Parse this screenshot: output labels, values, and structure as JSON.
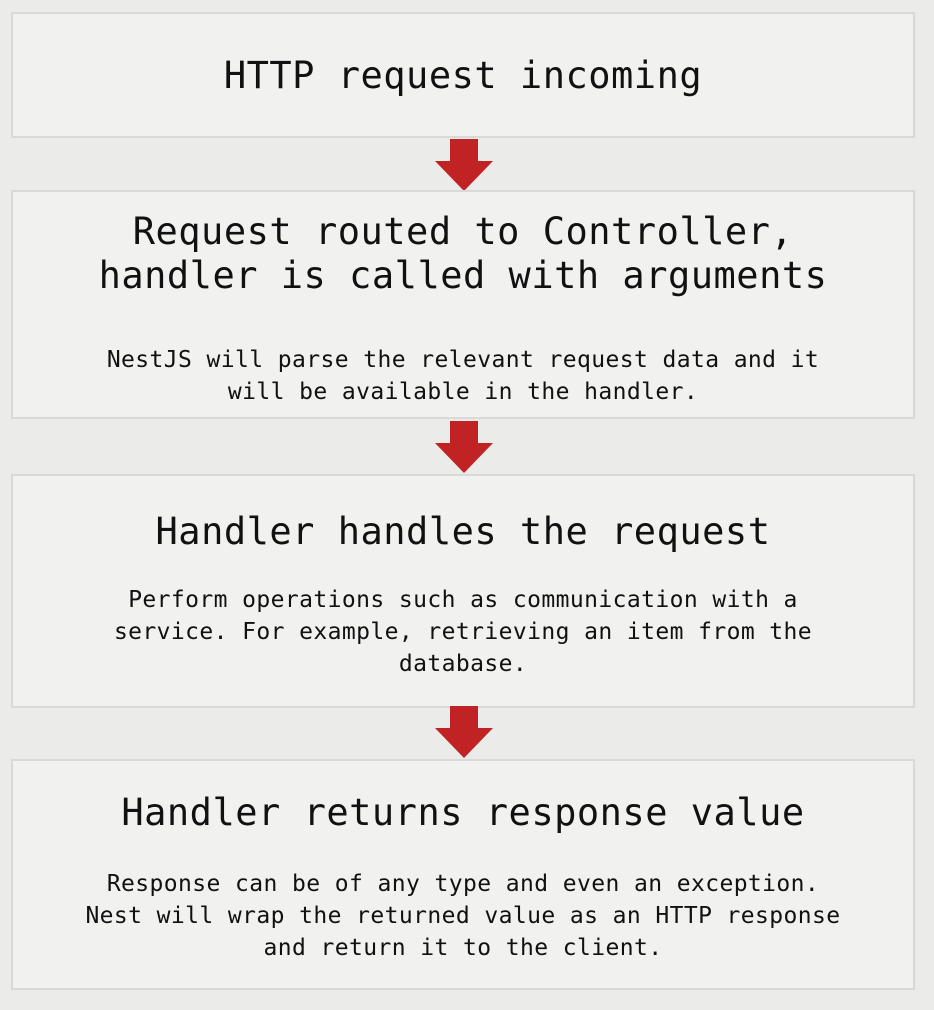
{
  "colors": {
    "background": "#ebebea",
    "box_fill": "#f1f1f0",
    "box_border": "#d9d9d8",
    "arrow": "#c12324",
    "text": "#111111"
  },
  "steps": [
    {
      "title": "HTTP request incoming",
      "description": ""
    },
    {
      "title": "Request routed to Controller,\nhandler is called with arguments",
      "description": "NestJS will parse the relevant request data and it\nwill be available in the handler."
    },
    {
      "title": "Handler handles the request",
      "description": "Perform operations such as communication with a\nservice. For example, retrieving an item from the\ndatabase."
    },
    {
      "title": "Handler returns response value",
      "description": "Response can be of any type and even an exception.\nNest will wrap the returned value as an HTTP response\nand return it to the client."
    }
  ],
  "connectors": [
    {
      "from": 0,
      "to": 1,
      "icon": "down-arrow-icon"
    },
    {
      "from": 1,
      "to": 2,
      "icon": "down-arrow-icon"
    },
    {
      "from": 2,
      "to": 3,
      "icon": "down-arrow-icon"
    }
  ]
}
